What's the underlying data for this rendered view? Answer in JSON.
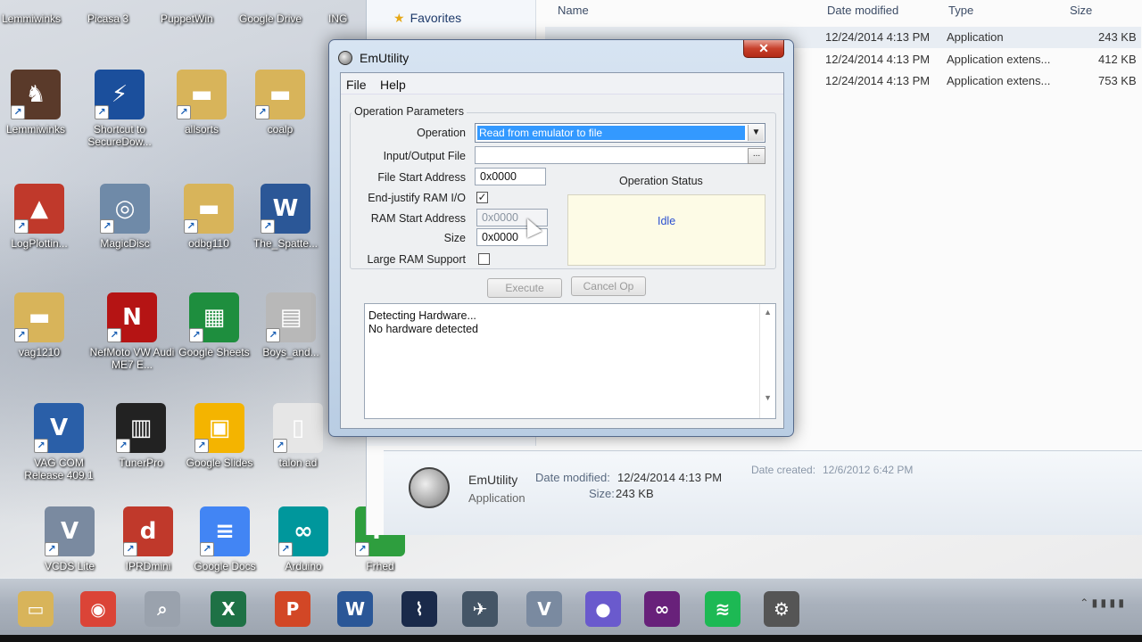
{
  "desktop": {
    "top_row": [
      "Lemmiwinks",
      "Picasa 3",
      "PuppetWin",
      "Google Drive",
      "ING"
    ],
    "icons_row1": [
      {
        "label": "Lemmiwinks",
        "icon": "horse-icon",
        "color": "#5a3a2a"
      },
      {
        "label": "Shortcut to SecureDow...",
        "icon": "lightning-icon",
        "color": "#1b4f9c"
      },
      {
        "label": "allsorts",
        "icon": "folder-icon",
        "color": "#d8b45a"
      },
      {
        "label": "coalp",
        "icon": "folder-icon",
        "color": "#d8b45a"
      }
    ],
    "icons_row2": [
      {
        "label": "LogPlottin...",
        "icon": "tractor-icon",
        "color": "#c0392b"
      },
      {
        "label": "MagicDisc",
        "icon": "disc-icon",
        "color": "#6f8aa8"
      },
      {
        "label": "odbg110",
        "icon": "folder-icon",
        "color": "#d8b45a"
      },
      {
        "label": "The_Spatte...",
        "icon": "word-doc-icon",
        "color": "#2b5797"
      }
    ],
    "icons_row3": [
      {
        "label": "vag1210",
        "icon": "folder-icon",
        "color": "#d8b45a"
      },
      {
        "label": "NefMoto VW Audi ME7 E...",
        "icon": "nefmoto-icon",
        "color": "#b51414"
      },
      {
        "label": "Google Sheets",
        "icon": "sheets-icon",
        "color": "#1e8e3e"
      },
      {
        "label": "Boys_and...",
        "icon": "pdf-icon",
        "color": "#b8b8b8"
      }
    ],
    "icons_row4": [
      {
        "label": "VAG COM Release 409.1",
        "icon": "vag-com-icon",
        "color": "#2a5fa8"
      },
      {
        "label": "TunerPro",
        "icon": "chip-icon",
        "color": "#222222"
      },
      {
        "label": "Google Slides",
        "icon": "slides-icon",
        "color": "#f4b400"
      },
      {
        "label": "talon ad",
        "icon": "file-icon",
        "color": "#e6e6e6"
      }
    ],
    "icons_row5": [
      {
        "label": "VCDS Lite",
        "icon": "vcds-icon",
        "color": "#7a8aa0"
      },
      {
        "label": "IPRDmini",
        "icon": "diet-icon",
        "color": "#c0392b"
      },
      {
        "label": "Google Docs",
        "icon": "docs-icon",
        "color": "#4285f4"
      },
      {
        "label": "Arduino",
        "icon": "arduino-icon",
        "color": "#00979c"
      },
      {
        "label": "Frhed",
        "icon": "frhed-icon",
        "color": "#2e9e3e"
      }
    ]
  },
  "explorer": {
    "nav_favorites": "Favorites",
    "columns": {
      "name": "Name",
      "date_modified": "Date modified",
      "type": "Type",
      "size": "Size"
    },
    "rows": [
      {
        "date": "12/24/2014 4:13 PM",
        "type": "Application",
        "size": "243 KB"
      },
      {
        "date": "12/24/2014 4:13 PM",
        "type": "Application extens...",
        "size": "412 KB"
      },
      {
        "date": "12/24/2014 4:13 PM",
        "type": "Application extens...",
        "size": "753 KB"
      }
    ],
    "details": {
      "name": "EmUtility",
      "kind": "Application",
      "date_modified_label": "Date modified:",
      "date_modified_value": "12/24/2014 4:13 PM",
      "size_label": "Size:",
      "size_value": "243 KB",
      "date_created_label": "Date created:",
      "date_created_value": "12/6/2012 6:42 PM"
    }
  },
  "dialog": {
    "title": "EmUtility",
    "close": "✕",
    "menu": {
      "file": "File",
      "help": "Help"
    },
    "group_title": "Operation Parameters",
    "operation_label": "Operation",
    "operation_value": "Read from emulator to file",
    "io_file_label": "Input/Output File",
    "io_file_value": "",
    "browse": "...",
    "file_start_label": "File Start Address",
    "file_start_value": "0x0000",
    "end_justify_label": "End-justify RAM I/O",
    "end_justify_checked": "✓",
    "ram_start_label": "RAM Start Address",
    "ram_start_value": "0x0000",
    "size_label": "Size",
    "size_value": "0x0000",
    "large_ram_label": "Large RAM Support",
    "status_heading": "Operation Status",
    "status_value": "Idle",
    "execute": "Execute",
    "cancel": "Cancel Op",
    "log": [
      "Detecting Hardware...",
      "No hardware detected"
    ]
  },
  "taskbar": {
    "apps": [
      {
        "name": "explorer",
        "icon": "folder-icon",
        "color": "#d8b45a"
      },
      {
        "name": "chrome",
        "icon": "chrome-icon",
        "color": "#db4437"
      },
      {
        "name": "app-3",
        "icon": "magnifier-icon",
        "color": "#9aa2ad"
      },
      {
        "name": "excel",
        "icon": "excel-icon",
        "color": "#1e7145"
      },
      {
        "name": "powerpoint",
        "icon": "powerpoint-icon",
        "color": "#d24726"
      },
      {
        "name": "word",
        "icon": "word-icon",
        "color": "#2b5797"
      },
      {
        "name": "app-7",
        "icon": "chart-icon",
        "color": "#1a2a4a"
      },
      {
        "name": "app-8",
        "icon": "plane-icon",
        "color": "#445566"
      },
      {
        "name": "vcds-lite",
        "icon": "vcds-icon",
        "color": "#7a8aa0"
      },
      {
        "name": "app-10",
        "icon": "orb-icon",
        "color": "#6a5acd"
      },
      {
        "name": "visual-studio",
        "icon": "vs-icon",
        "color": "#68217a"
      },
      {
        "name": "spotify",
        "icon": "spotify-icon",
        "color": "#1db954"
      },
      {
        "name": "emutility",
        "icon": "gear-icon",
        "color": "#555555"
      }
    ],
    "glyphs": {
      "folder-icon": "▭",
      "chrome-icon": "◉",
      "magnifier-icon": "⌕",
      "excel-icon": "X",
      "powerpoint-icon": "P",
      "word-icon": "W",
      "chart-icon": "⌇",
      "plane-icon": "✈",
      "vcds-icon": "V",
      "orb-icon": "●",
      "vs-icon": "∞",
      "spotify-icon": "≋",
      "gear-icon": "⚙"
    }
  }
}
